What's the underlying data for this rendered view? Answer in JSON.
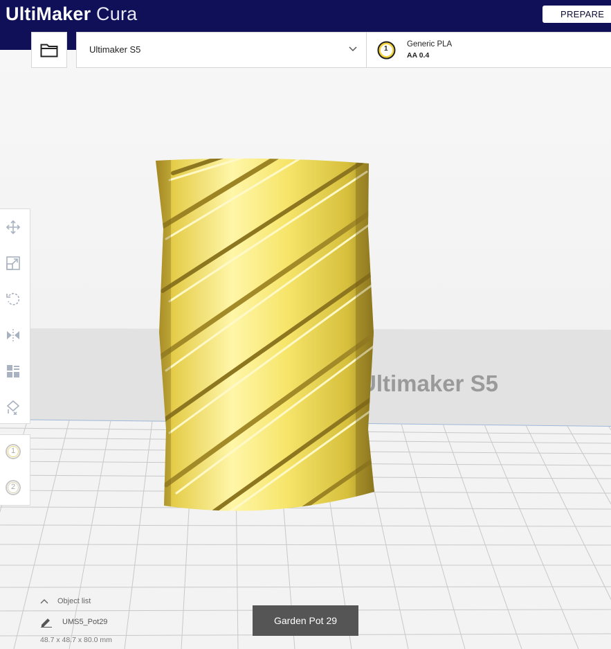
{
  "app": {
    "brand_bold": "UltiMaker",
    "brand_light": "Cura"
  },
  "header": {
    "stage_label": "PREPARE"
  },
  "printer": {
    "name": "Ultimaker S5",
    "extruder_number": "1",
    "material": "Generic PLA",
    "nozzle": "AA 0.4"
  },
  "viewport": {
    "build_plate_label": "Ultimaker S5",
    "model_color": "#f5e35a"
  },
  "toolbar": {
    "tools": [
      "move-icon",
      "scale-icon",
      "rotate-icon",
      "mirror-icon",
      "per-model-settings-icon",
      "support-blocker-icon"
    ],
    "extruders": [
      "1",
      "2"
    ]
  },
  "object_list": {
    "header": "Object list",
    "item_name": "UMS5_Pot29",
    "dimensions": "48.7 x 48.7 x 80.0 mm"
  },
  "job": {
    "name": "Garden Pot 29"
  }
}
